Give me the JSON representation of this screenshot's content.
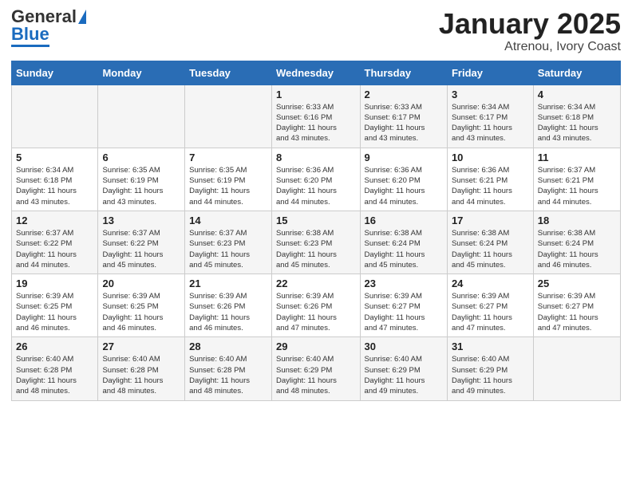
{
  "logo": {
    "general": "General",
    "blue": "Blue"
  },
  "header": {
    "month": "January 2025",
    "location": "Atrenou, Ivory Coast"
  },
  "days_of_week": [
    "Sunday",
    "Monday",
    "Tuesday",
    "Wednesday",
    "Thursday",
    "Friday",
    "Saturday"
  ],
  "weeks": [
    [
      {
        "num": "",
        "info": ""
      },
      {
        "num": "",
        "info": ""
      },
      {
        "num": "",
        "info": ""
      },
      {
        "num": "1",
        "info": "Sunrise: 6:33 AM\nSunset: 6:16 PM\nDaylight: 11 hours\nand 43 minutes."
      },
      {
        "num": "2",
        "info": "Sunrise: 6:33 AM\nSunset: 6:17 PM\nDaylight: 11 hours\nand 43 minutes."
      },
      {
        "num": "3",
        "info": "Sunrise: 6:34 AM\nSunset: 6:17 PM\nDaylight: 11 hours\nand 43 minutes."
      },
      {
        "num": "4",
        "info": "Sunrise: 6:34 AM\nSunset: 6:18 PM\nDaylight: 11 hours\nand 43 minutes."
      }
    ],
    [
      {
        "num": "5",
        "info": "Sunrise: 6:34 AM\nSunset: 6:18 PM\nDaylight: 11 hours\nand 43 minutes."
      },
      {
        "num": "6",
        "info": "Sunrise: 6:35 AM\nSunset: 6:19 PM\nDaylight: 11 hours\nand 43 minutes."
      },
      {
        "num": "7",
        "info": "Sunrise: 6:35 AM\nSunset: 6:19 PM\nDaylight: 11 hours\nand 44 minutes."
      },
      {
        "num": "8",
        "info": "Sunrise: 6:36 AM\nSunset: 6:20 PM\nDaylight: 11 hours\nand 44 minutes."
      },
      {
        "num": "9",
        "info": "Sunrise: 6:36 AM\nSunset: 6:20 PM\nDaylight: 11 hours\nand 44 minutes."
      },
      {
        "num": "10",
        "info": "Sunrise: 6:36 AM\nSunset: 6:21 PM\nDaylight: 11 hours\nand 44 minutes."
      },
      {
        "num": "11",
        "info": "Sunrise: 6:37 AM\nSunset: 6:21 PM\nDaylight: 11 hours\nand 44 minutes."
      }
    ],
    [
      {
        "num": "12",
        "info": "Sunrise: 6:37 AM\nSunset: 6:22 PM\nDaylight: 11 hours\nand 44 minutes."
      },
      {
        "num": "13",
        "info": "Sunrise: 6:37 AM\nSunset: 6:22 PM\nDaylight: 11 hours\nand 45 minutes."
      },
      {
        "num": "14",
        "info": "Sunrise: 6:37 AM\nSunset: 6:23 PM\nDaylight: 11 hours\nand 45 minutes."
      },
      {
        "num": "15",
        "info": "Sunrise: 6:38 AM\nSunset: 6:23 PM\nDaylight: 11 hours\nand 45 minutes."
      },
      {
        "num": "16",
        "info": "Sunrise: 6:38 AM\nSunset: 6:24 PM\nDaylight: 11 hours\nand 45 minutes."
      },
      {
        "num": "17",
        "info": "Sunrise: 6:38 AM\nSunset: 6:24 PM\nDaylight: 11 hours\nand 45 minutes."
      },
      {
        "num": "18",
        "info": "Sunrise: 6:38 AM\nSunset: 6:24 PM\nDaylight: 11 hours\nand 46 minutes."
      }
    ],
    [
      {
        "num": "19",
        "info": "Sunrise: 6:39 AM\nSunset: 6:25 PM\nDaylight: 11 hours\nand 46 minutes."
      },
      {
        "num": "20",
        "info": "Sunrise: 6:39 AM\nSunset: 6:25 PM\nDaylight: 11 hours\nand 46 minutes."
      },
      {
        "num": "21",
        "info": "Sunrise: 6:39 AM\nSunset: 6:26 PM\nDaylight: 11 hours\nand 46 minutes."
      },
      {
        "num": "22",
        "info": "Sunrise: 6:39 AM\nSunset: 6:26 PM\nDaylight: 11 hours\nand 47 minutes."
      },
      {
        "num": "23",
        "info": "Sunrise: 6:39 AM\nSunset: 6:27 PM\nDaylight: 11 hours\nand 47 minutes."
      },
      {
        "num": "24",
        "info": "Sunrise: 6:39 AM\nSunset: 6:27 PM\nDaylight: 11 hours\nand 47 minutes."
      },
      {
        "num": "25",
        "info": "Sunrise: 6:39 AM\nSunset: 6:27 PM\nDaylight: 11 hours\nand 47 minutes."
      }
    ],
    [
      {
        "num": "26",
        "info": "Sunrise: 6:40 AM\nSunset: 6:28 PM\nDaylight: 11 hours\nand 48 minutes."
      },
      {
        "num": "27",
        "info": "Sunrise: 6:40 AM\nSunset: 6:28 PM\nDaylight: 11 hours\nand 48 minutes."
      },
      {
        "num": "28",
        "info": "Sunrise: 6:40 AM\nSunset: 6:28 PM\nDaylight: 11 hours\nand 48 minutes."
      },
      {
        "num": "29",
        "info": "Sunrise: 6:40 AM\nSunset: 6:29 PM\nDaylight: 11 hours\nand 48 minutes."
      },
      {
        "num": "30",
        "info": "Sunrise: 6:40 AM\nSunset: 6:29 PM\nDaylight: 11 hours\nand 49 minutes."
      },
      {
        "num": "31",
        "info": "Sunrise: 6:40 AM\nSunset: 6:29 PM\nDaylight: 11 hours\nand 49 minutes."
      },
      {
        "num": "",
        "info": ""
      }
    ]
  ]
}
